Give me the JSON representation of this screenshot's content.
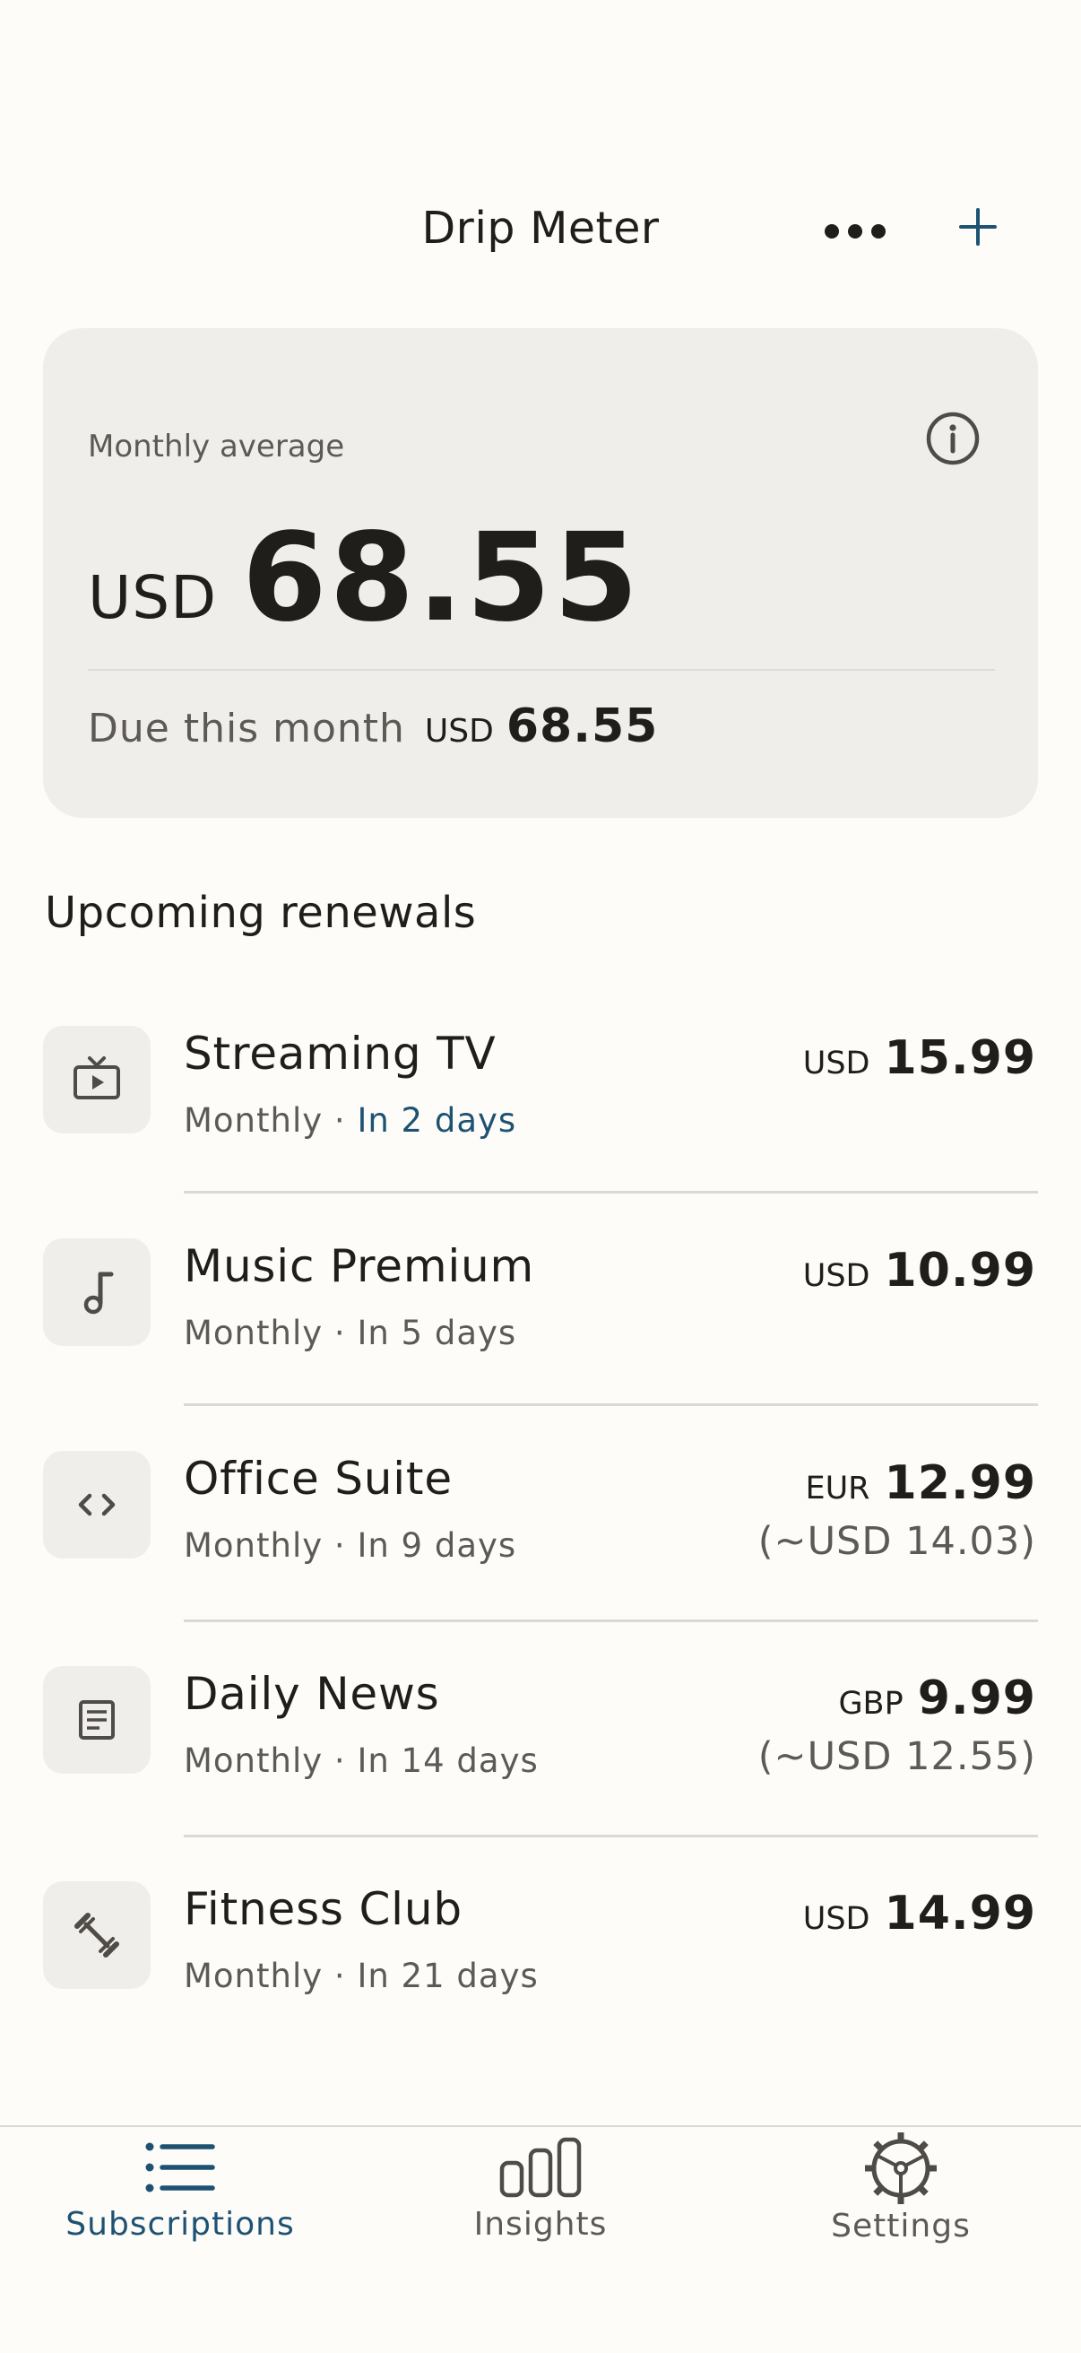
{
  "header": {
    "title": "Drip Meter",
    "more_icon": "more-horizontal-icon",
    "add_icon": "plus-icon"
  },
  "summary": {
    "label": "Monthly average",
    "currency": "USD",
    "amount": "68.55",
    "due_label": "Due this month",
    "due_currency": "USD",
    "due_amount": "68.55",
    "info_icon": "info-icon"
  },
  "section_title": "Upcoming renewals",
  "subscriptions": [
    {
      "icon": "tv-icon",
      "name": "Streaming TV",
      "cycle": "Monthly · ",
      "renewal": "In 2 days",
      "currency": "USD",
      "amount": "15.99",
      "converted": "",
      "soon": true
    },
    {
      "icon": "music-note-icon",
      "name": "Music Premium",
      "cycle": "Monthly · ",
      "renewal": "In 5 days",
      "currency": "USD",
      "amount": "10.99",
      "converted": "",
      "soon": false
    },
    {
      "icon": "code-icon",
      "name": "Office Suite",
      "cycle": "Monthly · ",
      "renewal": "In 9 days",
      "currency": "EUR",
      "amount": "12.99",
      "converted": "(~USD 14.03)",
      "soon": false
    },
    {
      "icon": "newspaper-icon",
      "name": "Daily News",
      "cycle": "Monthly · ",
      "renewal": "In 14 days",
      "currency": "GBP",
      "amount": "9.99",
      "converted": "(~USD 12.55)",
      "soon": false
    },
    {
      "icon": "dumbbell-icon",
      "name": "Fitness Club",
      "cycle": "Monthly · ",
      "renewal": "In 21 days",
      "currency": "USD",
      "amount": "14.99",
      "converted": "",
      "soon": false
    }
  ],
  "tabs": [
    {
      "label": "Subscriptions",
      "icon": "list-icon",
      "active": true
    },
    {
      "label": "Insights",
      "icon": "bar-chart-icon",
      "active": false
    },
    {
      "label": "Settings",
      "icon": "gear-icon",
      "active": false
    }
  ],
  "colors": {
    "background": "#fdfcf9",
    "card": "#f0eeea",
    "accent": "#1e5273",
    "text": "#1f1e1b",
    "secondary": "#5d5a55",
    "divider": "#dcd9d3"
  }
}
